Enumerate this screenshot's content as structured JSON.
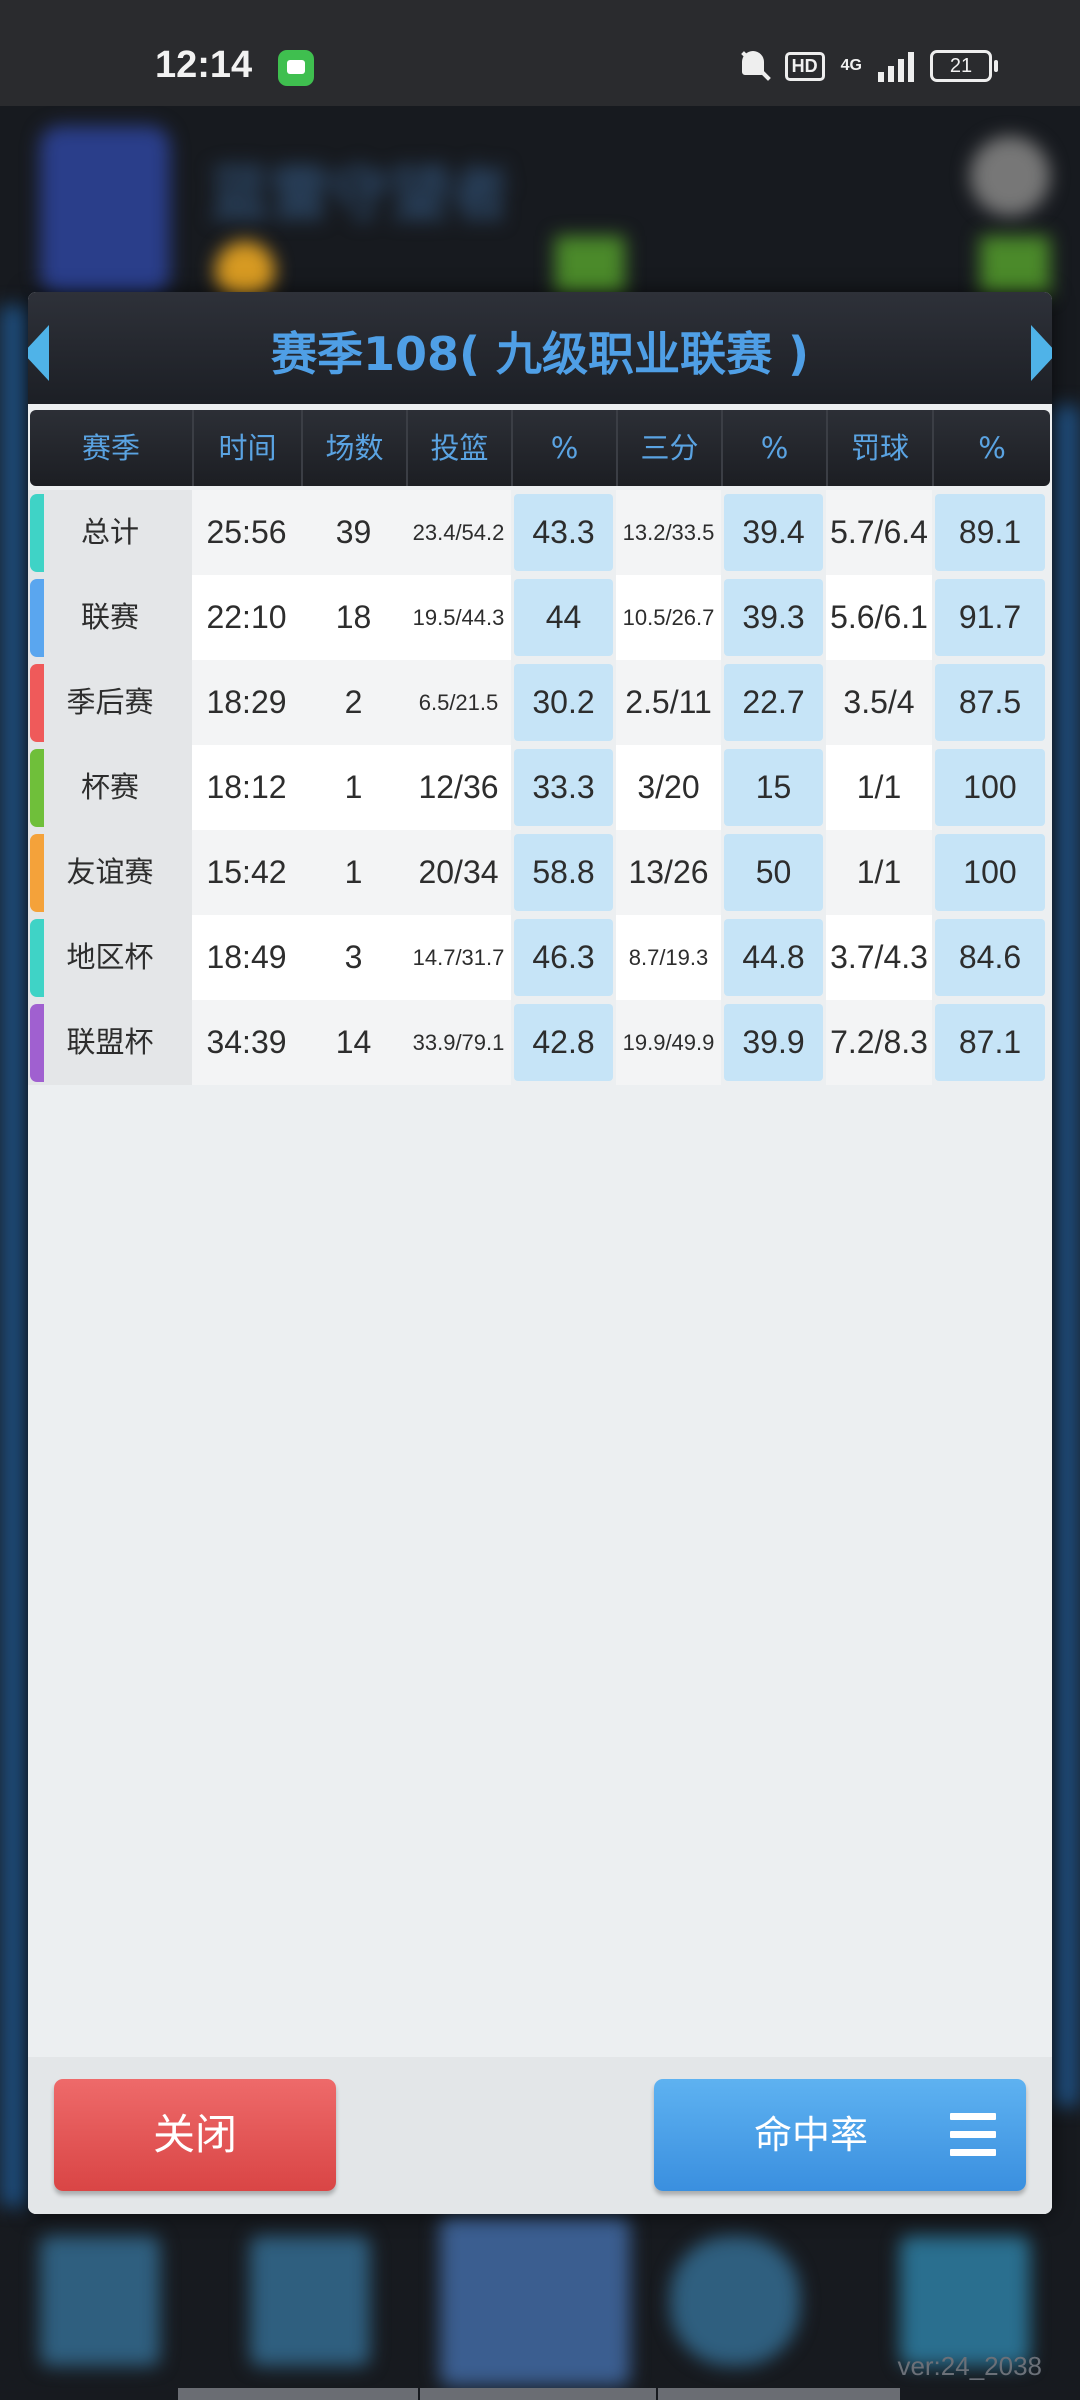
{
  "status_bar": {
    "time": "12:14",
    "hd": "HD",
    "network": "4G",
    "battery": "21"
  },
  "background": {
    "title": "蓝雷守望者"
  },
  "dialog": {
    "title": "赛季108( 九级职业联赛 )",
    "columns": [
      "赛季",
      "时间",
      "场数",
      "投篮",
      "%",
      "三分",
      "%",
      "罚球",
      "%"
    ],
    "rows": [
      {
        "name": "总计",
        "time": "25:56",
        "games": "39",
        "fg": "23.4/54.2",
        "fg_pct": "43.3",
        "three": "13.2/33.5",
        "three_pct": "39.4",
        "ft": "5.7/6.4",
        "ft_pct": "89.1",
        "accent": "#3fd3c6"
      },
      {
        "name": "联赛",
        "time": "22:10",
        "games": "18",
        "fg": "19.5/44.3",
        "fg_pct": "44",
        "three": "10.5/26.7",
        "three_pct": "39.3",
        "ft": "5.6/6.1",
        "ft_pct": "91.7",
        "accent": "#5aa6ef"
      },
      {
        "name": "季后赛",
        "time": "18:29",
        "games": "2",
        "fg": "6.5/21.5",
        "fg_pct": "30.2",
        "three": "2.5/11",
        "three_pct": "22.7",
        "ft": "3.5/4",
        "ft_pct": "87.5",
        "accent": "#ef5a5a"
      },
      {
        "name": "杯赛",
        "time": "18:12",
        "games": "1",
        "fg": "12/36",
        "fg_pct": "33.3",
        "three": "3/20",
        "three_pct": "15",
        "ft": "1/1",
        "ft_pct": "100",
        "accent": "#6fbf3a"
      },
      {
        "name": "友谊赛",
        "time": "15:42",
        "games": "1",
        "fg": "20/34",
        "fg_pct": "58.8",
        "three": "13/26",
        "three_pct": "50",
        "ft": "1/1",
        "ft_pct": "100",
        "accent": "#f4a23a"
      },
      {
        "name": "地区杯",
        "time": "18:49",
        "games": "3",
        "fg": "14.7/31.7",
        "fg_pct": "46.3",
        "three": "8.7/19.3",
        "three_pct": "44.8",
        "ft": "3.7/4.3",
        "ft_pct": "84.6",
        "accent": "#3fd3c6"
      },
      {
        "name": "联盟杯",
        "time": "34:39",
        "games": "14",
        "fg": "33.9/79.1",
        "fg_pct": "42.8",
        "three": "19.9/49.9",
        "three_pct": "39.9",
        "ft": "7.2/8.3",
        "ft_pct": "87.1",
        "accent": "#a060d0"
      }
    ],
    "close_label": "关闭",
    "mode_label": "命中率"
  },
  "version": "ver:24_2038"
}
